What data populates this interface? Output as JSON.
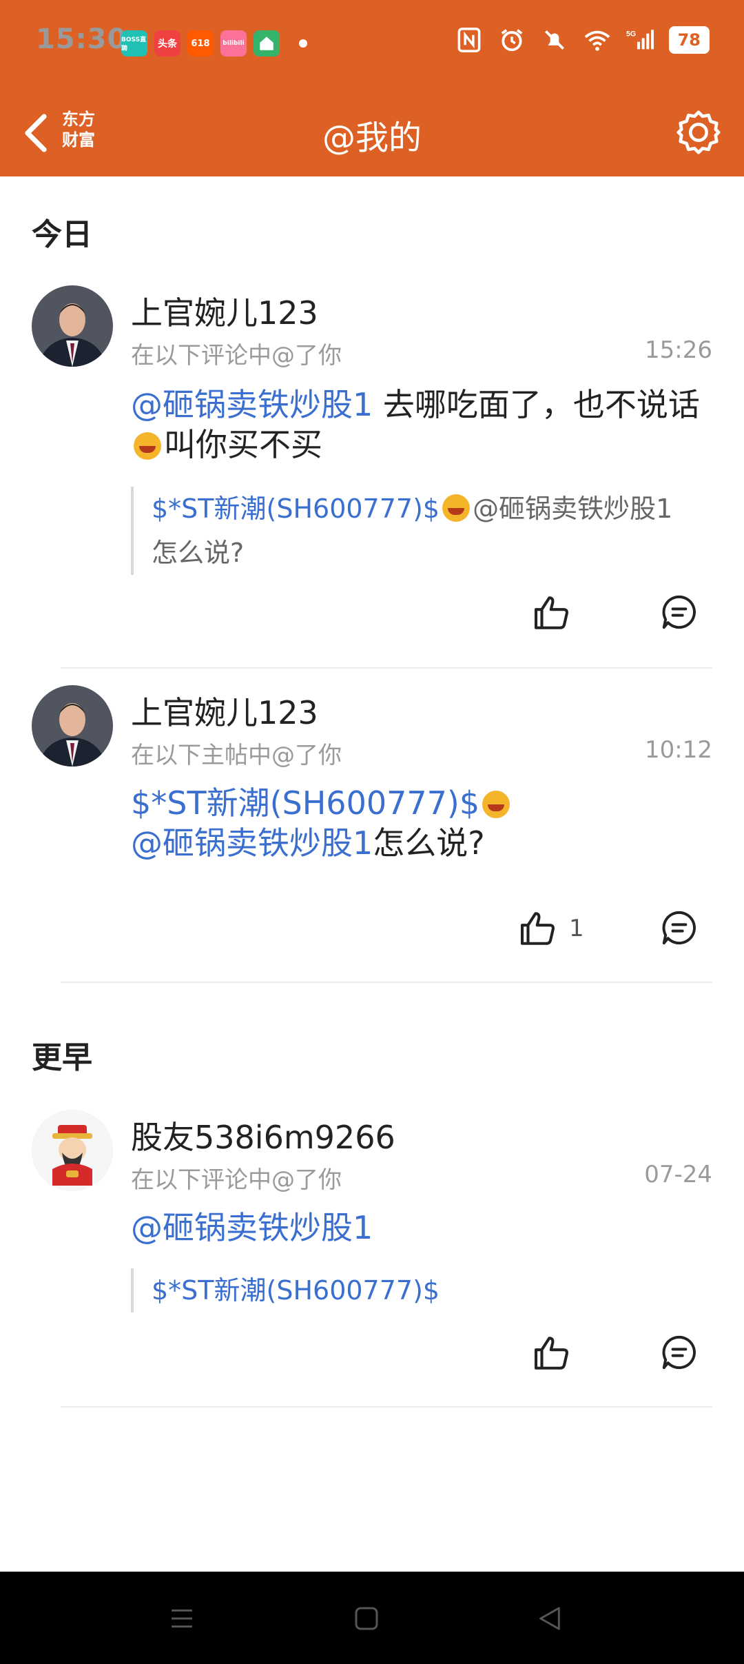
{
  "status_bar": {
    "time": "15:30",
    "app_icons": [
      {
        "name": "boss-zhipin-icon",
        "label": "BOSS直聘",
        "color": "#21c0b4"
      },
      {
        "name": "toutiao-icon",
        "label": "头条",
        "color": "#f04142"
      },
      {
        "name": "taobao-618-icon",
        "label": "618",
        "color": "#ff5a00"
      },
      {
        "name": "bilibili-icon",
        "label": "bilibili",
        "color": "#fb7299"
      },
      {
        "name": "home-app-icon",
        "label": "",
        "color": "#35b36b"
      }
    ],
    "battery": "78"
  },
  "header": {
    "logo_line1": "东方",
    "logo_line2": "财富",
    "title": "@我的"
  },
  "sections": {
    "today": "今日",
    "earlier": "更早"
  },
  "posts": [
    {
      "user": "上官婉儿123",
      "context": "在以下评论中@了你",
      "time": "15:26",
      "content_mention": "@砸锅卖铁炒股1",
      "content_text_1": " 去哪吃面了，也不说话",
      "content_text_2": "叫你买不买",
      "quote_stock": "$*ST新潮(SH600777)$",
      "quote_rest": "@砸锅卖铁炒股1",
      "quote_line2": "怎么说?",
      "likes": ""
    },
    {
      "user": "上官婉儿123",
      "context": "在以下主帖中@了你",
      "time": "10:12",
      "content_stock": "$*ST新潮(SH600777)$",
      "content_mention": "@砸锅卖铁炒股1",
      "content_text": "怎么说?",
      "likes": "1"
    },
    {
      "user": "股友538i6m9266",
      "context": "在以下评论中@了你",
      "time": "07-24",
      "content_mention": "@砸锅卖铁炒股1",
      "quote_stock": "$*ST新潮(SH600777)$",
      "likes": ""
    }
  ],
  "colors": {
    "brand": "#dd6124",
    "link": "#3a6fd0"
  }
}
